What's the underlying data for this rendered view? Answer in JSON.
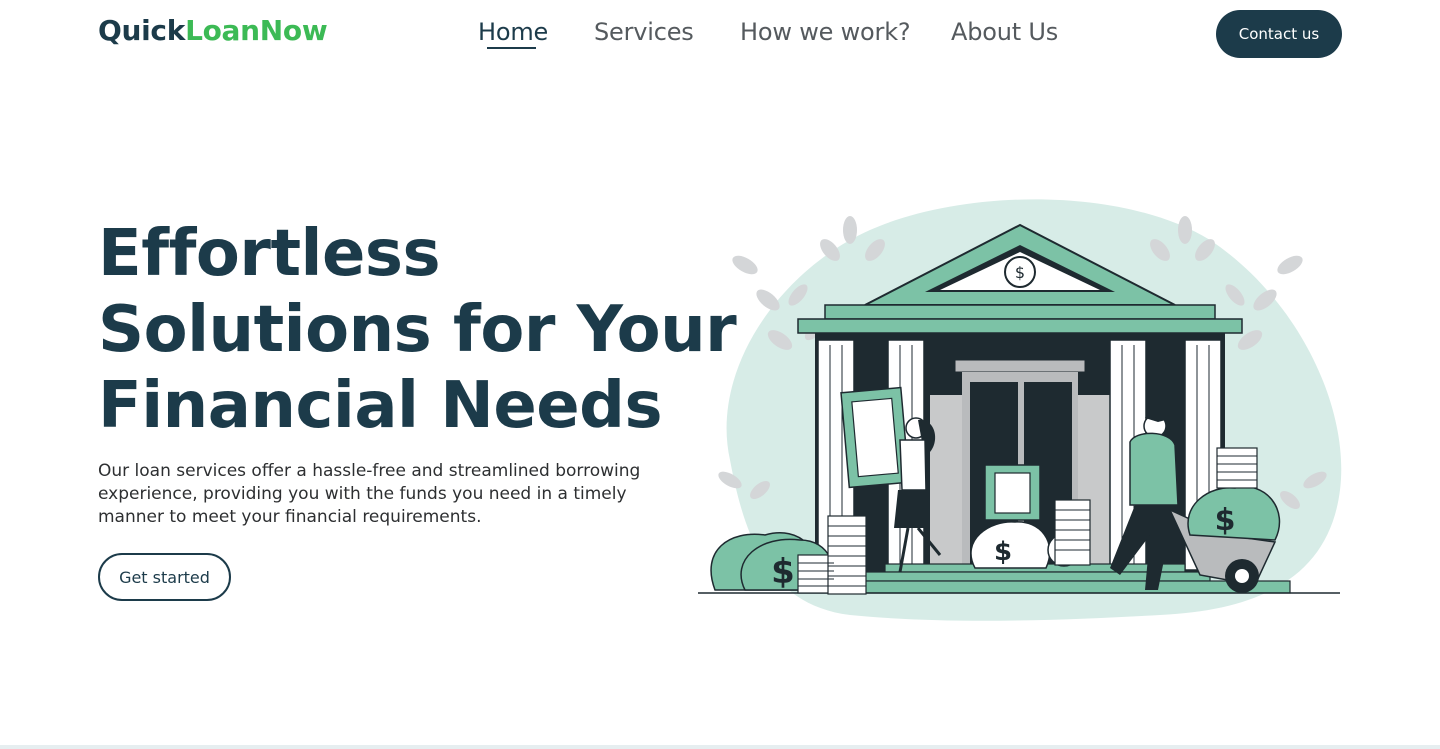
{
  "brand": {
    "part1": "Quick",
    "part2": "LoanNow"
  },
  "nav": {
    "items": [
      {
        "label": "Home",
        "active": true
      },
      {
        "label": "Services",
        "active": false
      },
      {
        "label": "How we work?",
        "active": false
      },
      {
        "label": "About Us",
        "active": false
      }
    ]
  },
  "header": {
    "contact_label": "Contact us"
  },
  "hero": {
    "title_lines": [
      "Effortless",
      "Solutions for Your",
      "Financial Needs"
    ],
    "description": "Our loan services offer a hassle-free and streamlined borrowing experience, providing you with the funds you need in a timely manner to meet your financial requirements.",
    "cta_label": "Get started",
    "illustration_icon": "bank-illustration"
  },
  "colors": {
    "primary": "#1c3b4a",
    "accent": "#3cba55",
    "teal": "#7cc2a6",
    "blob": "#d7ece7"
  }
}
